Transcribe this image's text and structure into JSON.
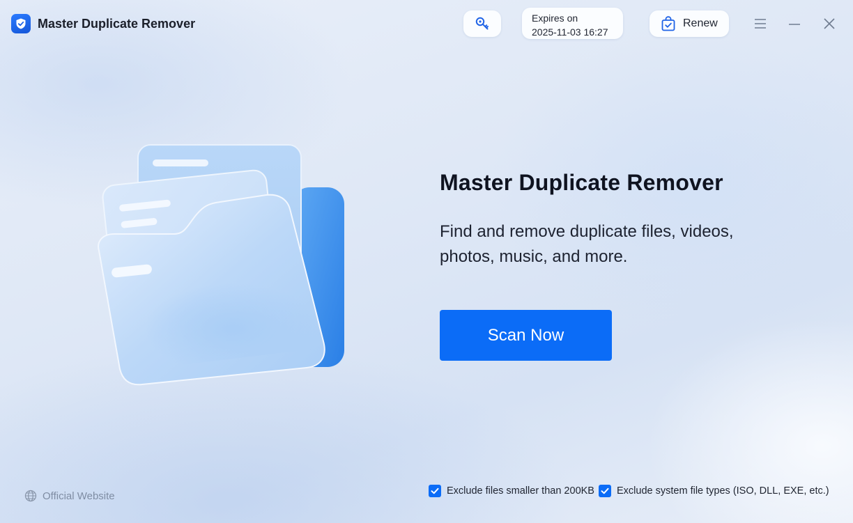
{
  "titlebar": {
    "app_title": "Master Duplicate Remover",
    "logo_icon": "shield-check-icon",
    "key_icon": "key-icon",
    "expires_label": "Expires on",
    "expires_value": "2025-11-03 16:27",
    "renew_label": "Renew",
    "renew_icon": "shopping-bag-check-icon",
    "menu_icon": "hamburger-menu-icon",
    "minimize_icon": "minimize-icon",
    "close_icon": "close-icon"
  },
  "main": {
    "illustration_icon": "folder-documents-icon",
    "title": "Master Duplicate Remover",
    "description_line1": "Find and remove duplicate files, videos,",
    "description_line2": "photos, music, and more.",
    "scan_button_label": "Scan Now"
  },
  "footer": {
    "official_website_label": "Official Website",
    "globe_icon": "globe-icon",
    "options": [
      {
        "label": "Exclude files smaller than 200KB",
        "checked": true
      },
      {
        "label": "Exclude system file types (ISO, DLL, EXE, etc.)",
        "checked": true
      }
    ]
  },
  "colors": {
    "accent": "#0b6cf7",
    "text_primary": "#0f1320",
    "link_muted": "#7f8da3"
  }
}
